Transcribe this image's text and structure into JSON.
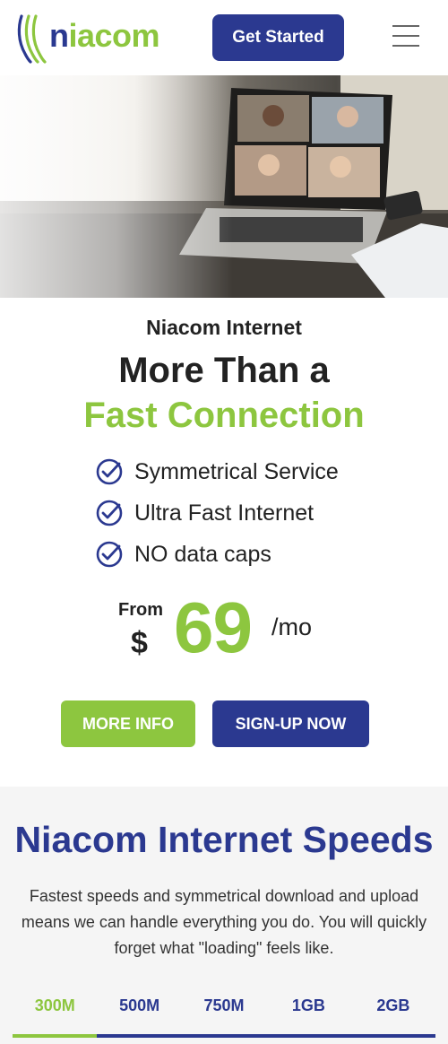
{
  "header": {
    "logo_text_first": "n",
    "logo_text_rest": "iacom",
    "cta_label": "Get Started"
  },
  "intro": {
    "eyebrow": "Niacom Internet",
    "headline_line1": "More Than a",
    "headline_line2": "Fast Connection",
    "features": [
      {
        "label": "Symmetrical Service",
        "icon": "check-circle-icon"
      },
      {
        "label": "Ultra Fast Internet",
        "icon": "check-circle-icon"
      },
      {
        "label": "NO data caps",
        "icon": "check-circle-icon"
      }
    ]
  },
  "price": {
    "from": "From",
    "currency": "$",
    "amount": "69",
    "period": "/mo"
  },
  "buttons": {
    "more_info": "MORE INFO",
    "signup": "SIGN-UP NOW"
  },
  "speeds": {
    "title": "Niacom Internet Speeds",
    "description": "Fastest speeds and symmetrical download and upload means we can handle everything you do. You will quickly forget what \"loading\" feels like.",
    "tabs": [
      {
        "label": "300M",
        "active": true
      },
      {
        "label": "500M",
        "active": false
      },
      {
        "label": "750M",
        "active": false
      },
      {
        "label": "1GB",
        "active": false
      },
      {
        "label": "2GB",
        "active": false
      }
    ]
  },
  "colors": {
    "brand_blue": "#2b3990",
    "brand_green": "#8dc63f"
  }
}
